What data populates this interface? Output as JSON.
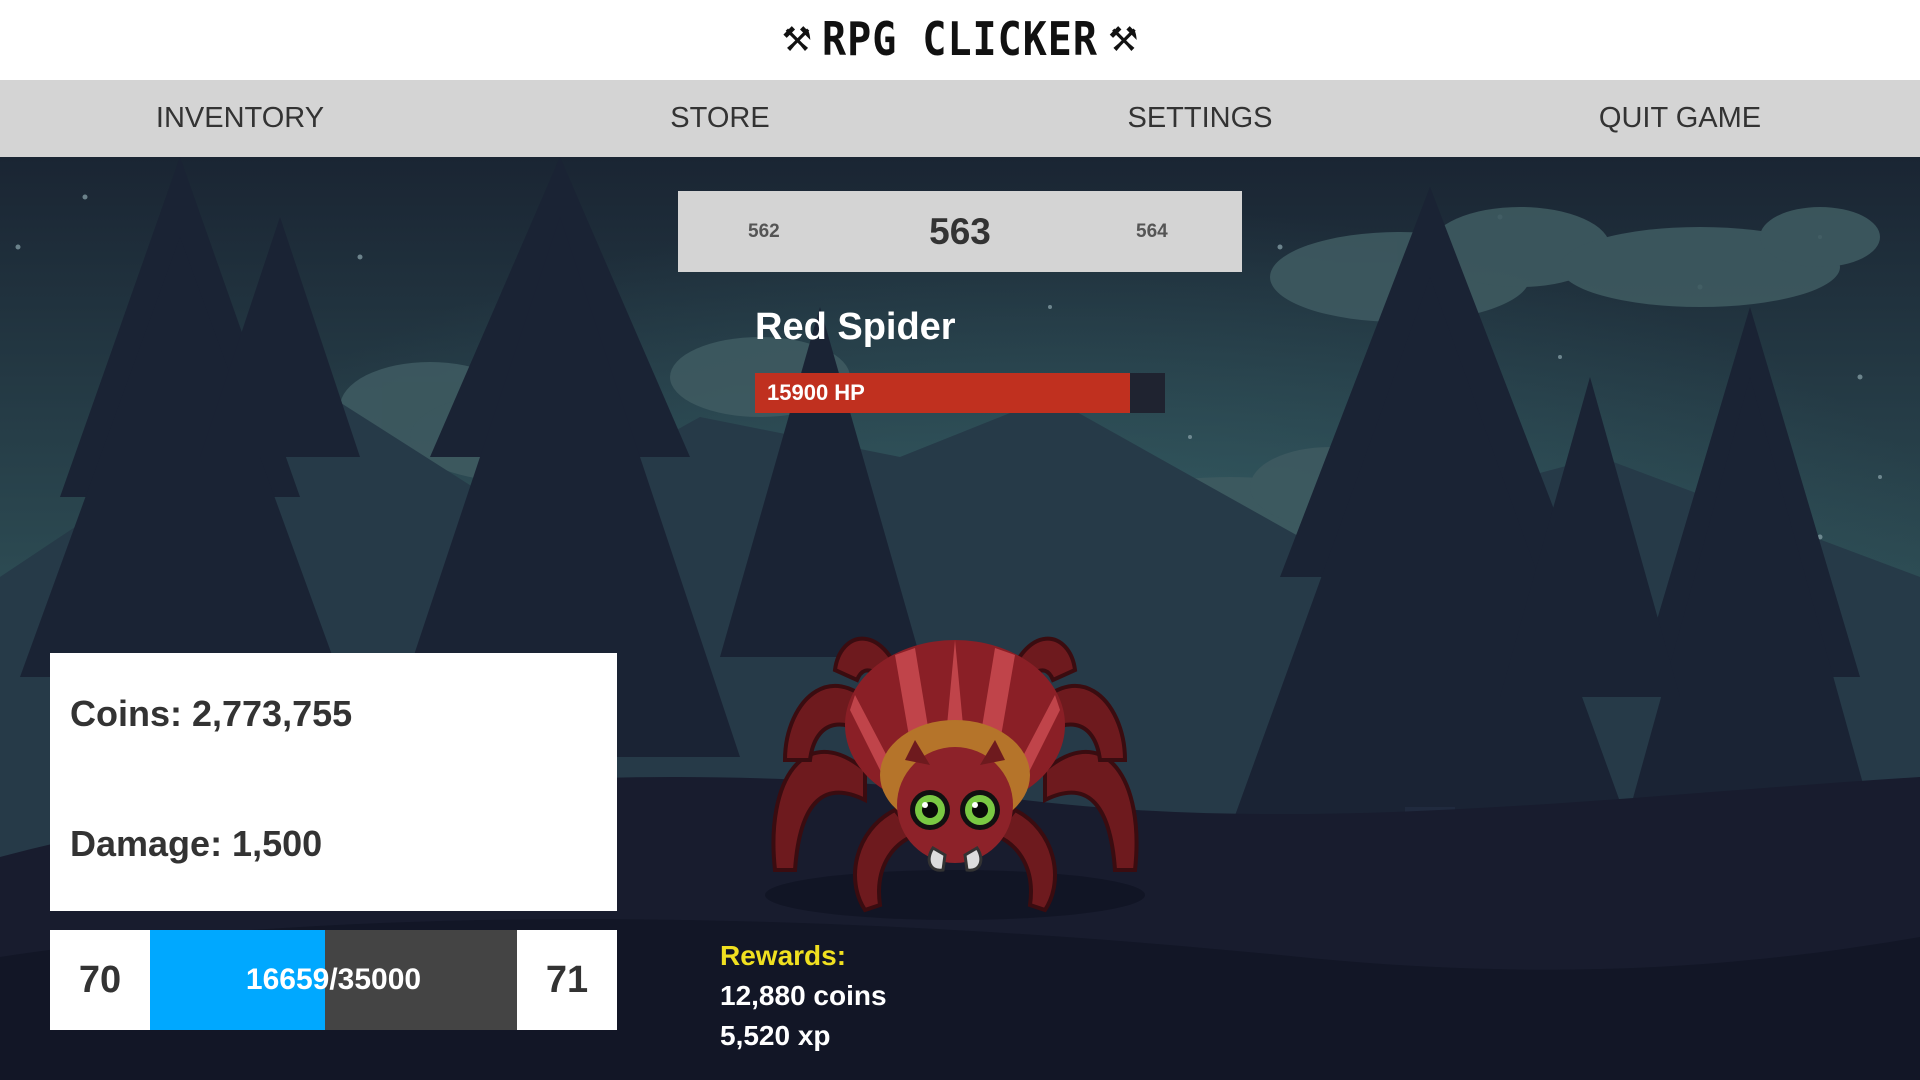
{
  "header": {
    "title": "RPG CLICKER"
  },
  "nav": {
    "inventory": "INVENTORY",
    "store": "STORE",
    "settings": "SETTINGS",
    "quit": "QUIT GAME"
  },
  "stage": {
    "previous": "562",
    "current": "563",
    "next": "564"
  },
  "monster": {
    "name": "Red Spider",
    "hp_text": "15900 HP",
    "hp_fraction": 0.915,
    "hp_color": "#c0301f"
  },
  "stats": {
    "coins": "Coins: 2,773,755",
    "damage": "Damage: 1,500"
  },
  "experience": {
    "level": "70",
    "next_level": "71",
    "current_xp": 16659,
    "required_xp": 35000,
    "text": "16659/35000",
    "bar_color": "#00a8ff"
  },
  "rewards": {
    "title": "Rewards:",
    "coins": "12,880 coins",
    "xp": "5,520 xp"
  },
  "icons": {
    "title_left": "axe-icon",
    "title_right": "axe-icon"
  }
}
